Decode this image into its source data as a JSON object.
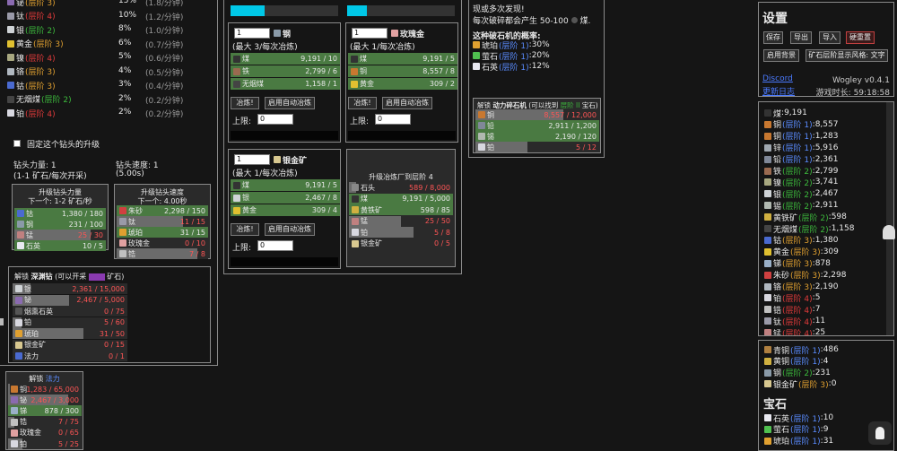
{
  "colors": {
    "panel_border": "#8a8a8a",
    "fill_green": "#4a7a42",
    "fill_gray": "#6b6b6b",
    "tier3": "#e0a030",
    "tier4": "#e03a3a",
    "tier2": "#3cb83c",
    "tier1": "#5a8cff",
    "accent_cyan": "#00c8e8"
  },
  "left_list": [
    {
      "name": "铋",
      "level": "(层阶 3)",
      "tier": "3",
      "pct": "15%",
      "rate": "(1.8/分钟)",
      "icon": "#8a6ab0"
    },
    {
      "name": "钛",
      "level": "(层阶 4)",
      "tier": "4",
      "pct": "10%",
      "rate": "(1.2/分钟)",
      "icon": "#9a9aa8"
    },
    {
      "name": "银",
      "level": "(层阶 2)",
      "tier": "2",
      "pct": "8%",
      "rate": "(1.0/分钟)",
      "icon": "#cfd3d6"
    },
    {
      "name": "黄金",
      "level": "(层阶 3)",
      "tier": "3",
      "pct": "6%",
      "rate": "(0.7/分钟)",
      "icon": "#e0c030"
    },
    {
      "name": "镍",
      "level": "(层阶 4)",
      "tier": "4",
      "pct": "5%",
      "rate": "(0.6/分钟)",
      "icon": "#a8a880"
    },
    {
      "name": "铬",
      "level": "(层阶 3)",
      "tier": "3",
      "pct": "4%",
      "rate": "(0.5/分钟)",
      "icon": "#b0b8c0"
    },
    {
      "name": "钴",
      "level": "(层阶 3)",
      "tier": "3",
      "pct": "3%",
      "rate": "(0.4/分钟)",
      "icon": "#4a6ad0"
    },
    {
      "name": "无烟煤",
      "level": "(层阶 2)",
      "tier": "2",
      "pct": "2%",
      "rate": "(0.2/分钟)",
      "icon": "#444"
    },
    {
      "name": "铂",
      "level": "(层阶 4)",
      "tier": "4",
      "pct": "2%",
      "rate": "(0.2/分钟)",
      "icon": "#d8d8e0"
    }
  ],
  "fix_upgrade": "固定这个钻头的升级",
  "drill_power": {
    "title": "钻头力量: 1",
    "sub": "(1-1 矿石/每次开采)",
    "box_title": "升级钻头力量",
    "box_sub": "下一个: 1-2 矿石/秒",
    "costs": [
      {
        "name": "钴",
        "val": "1,380 / 180",
        "fill": 1,
        "icon": "#4a6ad0"
      },
      {
        "name": "钢",
        "val": "231 / 100",
        "fill": 1,
        "icon": "#8a9aa8"
      },
      {
        "name": "锰",
        "val": "25 / 30",
        "fill": 0.83,
        "red": true,
        "icon": "#c08080"
      },
      {
        "name": "石英",
        "val": "10 / 5",
        "fill": 1,
        "icon": "#e8e8f0"
      }
    ]
  },
  "drill_speed": {
    "title": "钻头速度: 1",
    "sub": "(5.00s)",
    "box_title": "升级钻头速度",
    "box_sub": "下一个: 4.00秒",
    "costs": [
      {
        "name": "朱砂",
        "val": "2,298 / 150",
        "fill": 1,
        "icon": "#d04040"
      },
      {
        "name": "钛",
        "val": "11 / 15",
        "fill": 0.73,
        "red": true,
        "icon": "#9a9aa8"
      },
      {
        "name": "琥珀",
        "val": "31 / 15",
        "fill": 1,
        "icon": "#e0a030"
      },
      {
        "name": "玫瑰金",
        "val": "0 / 10",
        "fill": 0,
        "red": true,
        "icon": "#e0a0a0"
      },
      {
        "name": "锆",
        "val": "7 / 8",
        "fill": 0.88,
        "red": true,
        "icon": "#c0c0c0"
      }
    ]
  },
  "abyss": {
    "title_a": "解锁 ",
    "title_b": "深渊钻",
    "title_c": " (可以开采 ",
    "title_d": " 矿石)",
    "costs": [
      {
        "name": "银",
        "val": "2,361 / 15,000",
        "fill": 0.16,
        "red": true,
        "icon": "#cfd3d6"
      },
      {
        "name": "铋",
        "val": "2,467 / 5,000",
        "fill": 0.49,
        "red": true,
        "icon": "#8a6ab0"
      },
      {
        "name": "烟熏石英",
        "val": "0 / 75",
        "fill": 0,
        "red": true,
        "icon": "#555"
      },
      {
        "name": "铂",
        "val": "5 / 60",
        "fill": 0.08,
        "red": true,
        "icon": "#d8d8e0"
      },
      {
        "name": "琥珀",
        "val": "31 / 50",
        "fill": 0.62,
        "red": true,
        "icon": "#e0a030"
      },
      {
        "name": "银金矿",
        "val": "0 / 15",
        "fill": 0,
        "red": true,
        "icon": "#d8c890"
      },
      {
        "name": "法力",
        "val": "0 / 1",
        "fill": 0,
        "red": true,
        "icon": "#4a6ad0"
      }
    ]
  },
  "magic": {
    "title_a": "解锁 ",
    "title_b": "法力",
    "costs": [
      {
        "name": "铜",
        "val": "1,283 / 65,000",
        "fill": 0.02,
        "red": true,
        "icon": "#c87830"
      },
      {
        "name": "铋",
        "val": "2,467 / 3,000",
        "fill": 0.82,
        "red": true,
        "icon": "#8a6ab0"
      },
      {
        "name": "锑",
        "val": "878 / 300",
        "fill": 1,
        "icon": "#9ab0c8"
      },
      {
        "name": "锆",
        "val": "7 / 75",
        "fill": 0.09,
        "red": true,
        "icon": "#c0c0c0"
      },
      {
        "name": "玫瑰金",
        "val": "0 / 65",
        "fill": 0,
        "red": true,
        "icon": "#e0a0a0"
      },
      {
        "name": "铂",
        "val": "5 / 25",
        "fill": 0.2,
        "red": true,
        "icon": "#d8d8e0"
      }
    ]
  },
  "smelters": [
    {
      "id": "steel",
      "qty": "1",
      "name": "钢",
      "sub": "(最大 3/每次冶炼)",
      "icon": "#8a9aa8",
      "rows": [
        {
          "name": "煤",
          "val": "9,191 / 10",
          "icon": "#333"
        },
        {
          "name": "铁",
          "val": "2,799 / 6",
          "icon": "#9a6a50"
        },
        {
          "name": "无烟煤",
          "val": "1,158 / 1",
          "icon": "#444"
        }
      ],
      "smelt": "冶炼!",
      "auto": "启用自动冶炼",
      "limit": "上限:",
      "limit_val": "0"
    },
    {
      "id": "rosegold",
      "qty": "1",
      "name": "玫瑰金",
      "sub": "(最大 1/每次冶炼)",
      "icon": "#e0a0a0",
      "rows": [
        {
          "name": "煤",
          "val": "9,191 / 5",
          "icon": "#333"
        },
        {
          "name": "铜",
          "val": "8,557 / 8",
          "icon": "#c87830"
        },
        {
          "name": "黄金",
          "val": "309 / 2",
          "icon": "#e0c030"
        }
      ],
      "smelt": "冶炼!",
      "auto": "启用自动冶炼",
      "limit": "上限:",
      "limit_val": "0"
    },
    {
      "id": "electrum",
      "qty": "1",
      "name": "银金矿",
      "sub": "(最大 1/每次冶炼)",
      "icon": "#d8c890",
      "rows": [
        {
          "name": "煤",
          "val": "9,191 / 5",
          "icon": "#333"
        },
        {
          "name": "银",
          "val": "2,467 / 8",
          "icon": "#cfd3d6"
        },
        {
          "name": "黄金",
          "val": "309 / 4",
          "icon": "#e0c030"
        }
      ],
      "smelt": "冶炼!",
      "auto": "启用自动冶炼",
      "limit": "上限:",
      "limit_val": "0"
    }
  ],
  "smelter_upgrade": {
    "title": "升级冶炼厂到层阶 4",
    "costs": [
      {
        "name": "石头",
        "val": "589 / 8,000",
        "fill": 0.07,
        "red": true,
        "icon": "#888"
      },
      {
        "name": "煤",
        "val": "9,191 / 5,000",
        "fill": 1,
        "icon": "#333"
      },
      {
        "name": "黄铁矿",
        "val": "598 / 85",
        "fill": 1,
        "icon": "#d0b040"
      },
      {
        "name": "锰",
        "val": "25 / 50",
        "fill": 0.5,
        "red": true,
        "icon": "#c08080"
      },
      {
        "name": "铂",
        "val": "5 / 8",
        "fill": 0.62,
        "red": true,
        "icon": "#d8d8e0"
      },
      {
        "name": "银金矿",
        "val": "0 / 5",
        "fill": 0,
        "red": true,
        "icon": "#d8c890"
      }
    ]
  },
  "crusher": {
    "line1": "现或多次发现!",
    "line2": "每次破碎都会产生 50-100",
    "line2b": "煤.",
    "chance_title": "这种破石机的概率:",
    "chances": [
      {
        "name": "琥珀",
        "level": "(层阶 1)",
        "pct": "30%",
        "icon": "#e0a030"
      },
      {
        "name": "萤石",
        "level": "(层阶 1)",
        "pct": "20%",
        "icon": "#50c050"
      },
      {
        "name": "石英",
        "level": "(层阶 1)",
        "pct": "12%",
        "icon": "#e8e8f0"
      }
    ],
    "unlock_a": "解锁 ",
    "unlock_b": "动力碎石机",
    "unlock_c": " (可以找到 ",
    "unlock_d": "层阶 II",
    "unlock_e": " 宝石)",
    "costs": [
      {
        "name": "铜",
        "val": "8,557 / 12,000",
        "fill": 0.71,
        "red": true,
        "icon": "#c87830"
      },
      {
        "name": "铅",
        "val": "2,911 / 1,200",
        "fill": 1,
        "icon": "#808898"
      },
      {
        "name": "锡",
        "val": "2,190 / 120",
        "fill": 1,
        "icon": "#b0b8b0"
      },
      {
        "name": "铂",
        "val": "5 / 12",
        "fill": 0.42,
        "red": true,
        "icon": "#d8d8e0"
      }
    ]
  },
  "settings": {
    "title": "设置",
    "save": "保存",
    "export": "导出",
    "import": "导入",
    "hard_reset": "硬重置",
    "enable_bg": "启用背景",
    "ore_style": "矿石层阶显示风格: 文字",
    "discord": "Discord",
    "version": "Wogley v0.4.1",
    "changelog": "更新日志",
    "playtime_label": "游戏时长:",
    "playtime": "59:18:58"
  },
  "inventory": [
    {
      "name": "煤",
      "val": "9,191",
      "icon": "#333"
    },
    {
      "name": "铜",
      "level": "(层阶 1)",
      "tier": "1",
      "val": "8,557",
      "icon": "#c87830"
    },
    {
      "name": "铜",
      "level": "(层阶 1)",
      "tier": "1",
      "val": "1,283",
      "icon": "#c87830"
    },
    {
      "name": "锌",
      "level": "(层阶 1)",
      "tier": "1",
      "val": "5,916",
      "icon": "#a0a8b0"
    },
    {
      "name": "铅",
      "level": "(层阶 1)",
      "tier": "1",
      "val": "2,361",
      "icon": "#808898"
    },
    {
      "name": "铁",
      "level": "(层阶 2)",
      "tier": "2",
      "val": "2,799",
      "icon": "#9a6a50"
    },
    {
      "name": "镍",
      "level": "(层阶 2)",
      "tier": "2",
      "val": "3,741",
      "icon": "#a8a880"
    },
    {
      "name": "银",
      "level": "(层阶 2)",
      "tier": "2",
      "val": "2,467",
      "icon": "#cfd3d6"
    },
    {
      "name": "锡",
      "level": "(层阶 2)",
      "tier": "2",
      "val": "2,911",
      "icon": "#b0b8b0"
    },
    {
      "name": "黄铁矿",
      "level": "(层阶 2)",
      "tier": "2",
      "val": "598",
      "icon": "#d0b040"
    },
    {
      "name": "无烟煤",
      "level": "(层阶 2)",
      "tier": "2",
      "val": "1,158",
      "icon": "#444"
    },
    {
      "name": "钴",
      "level": "(层阶 3)",
      "tier": "3",
      "val": "1,380",
      "icon": "#4a6ad0"
    },
    {
      "name": "黄金",
      "level": "(层阶 3)",
      "tier": "3",
      "val": "309",
      "icon": "#e0c030"
    },
    {
      "name": "锑",
      "level": "(层阶 3)",
      "tier": "3",
      "val": "878",
      "icon": "#9ab0c8"
    },
    {
      "name": "朱砂",
      "level": "(层阶 3)",
      "tier": "3",
      "val": "2,298",
      "icon": "#d04040"
    },
    {
      "name": "铬",
      "level": "(层阶 3)",
      "tier": "3",
      "val": "2,190",
      "icon": "#b0b8c0"
    },
    {
      "name": "铂",
      "level": "(层阶 4)",
      "tier": "4",
      "val": "5",
      "icon": "#d8d8e0"
    },
    {
      "name": "锆",
      "level": "(层阶 4)",
      "tier": "4",
      "val": "7",
      "icon": "#c0c0c0"
    },
    {
      "name": "钛",
      "level": "(层阶 4)",
      "tier": "4",
      "val": "11",
      "icon": "#9a9aa8"
    },
    {
      "name": "锰",
      "level": "(层阶 4)",
      "tier": "4",
      "val": "25",
      "icon": "#c08080"
    }
  ],
  "alloys": [
    {
      "name": "青铜",
      "level": "(层阶 1)",
      "tier": "1",
      "val": "486",
      "icon": "#b08040"
    },
    {
      "name": "黄铜",
      "level": "(层阶 1)",
      "tier": "1",
      "val": "4",
      "icon": "#d0b040"
    },
    {
      "name": "钢",
      "level": "(层阶 2)",
      "tier": "2",
      "val": "231",
      "icon": "#8a9aa8"
    },
    {
      "name": "银金矿",
      "level": "(层阶 3)",
      "tier": "3",
      "val": "0",
      "icon": "#d8c890"
    }
  ],
  "gems_title": "宝石",
  "gems": [
    {
      "name": "石英",
      "level": "(层阶 1)",
      "tier": "1",
      "val": "10",
      "icon": "#e8e8f0"
    },
    {
      "name": "萤石",
      "level": "(层阶 1)",
      "tier": "1",
      "val": "9",
      "icon": "#50c050"
    },
    {
      "name": "琥珀",
      "level": "(层阶 1)",
      "tier": "1",
      "val": "31",
      "icon": "#e0a030"
    }
  ]
}
